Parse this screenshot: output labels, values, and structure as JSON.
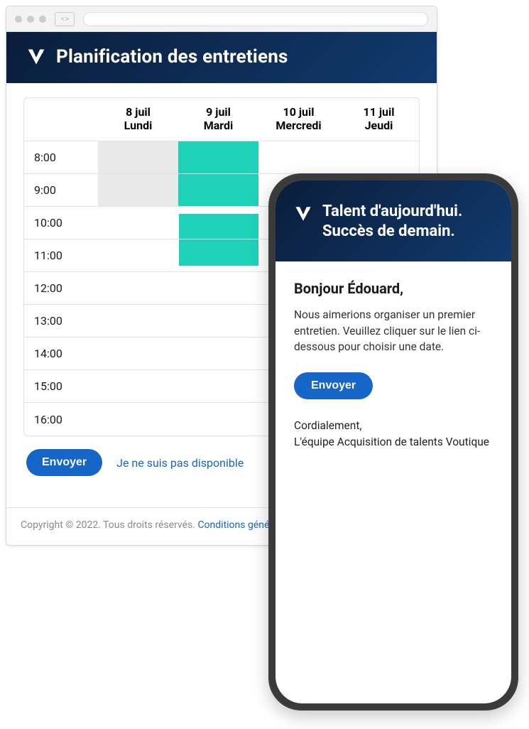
{
  "desktop": {
    "title": "Planification des entretiens",
    "days": [
      {
        "date": "8 juil",
        "dow": "Lundi"
      },
      {
        "date": "9 juil",
        "dow": "Mardi"
      },
      {
        "date": "10 juil",
        "dow": "Mercredi"
      },
      {
        "date": "11 juil",
        "dow": "Jeudi"
      }
    ],
    "hours": [
      "8:00",
      "9:00",
      "10:00",
      "11:00",
      "12:00",
      "13:00",
      "14:00",
      "15:00",
      "16:00"
    ],
    "send_label": "Envoyer",
    "not_available_label": "Je ne suis pas disponible",
    "footer_copyright": "Copyright © 2022. Tous droits réservés. ",
    "footer_link": "Conditions géné"
  },
  "phone": {
    "headline_line1": "Talent d'aujourd'hui.",
    "headline_line2": "Succès de demain.",
    "greeting": "Bonjour Édouard,",
    "body": "Nous aimerions organiser un premier entretien. Veuillez cliquer sur le lien ci-dessous pour choisir une date.",
    "send_label": "Envoyer",
    "sign_line1": "Cordialement,",
    "sign_line2": "L'équipe Acquisition de talents Voutique"
  },
  "colors": {
    "brand_dark": "#0e2d57",
    "accent_teal": "#1fd1b9",
    "primary_blue": "#1666c7"
  }
}
